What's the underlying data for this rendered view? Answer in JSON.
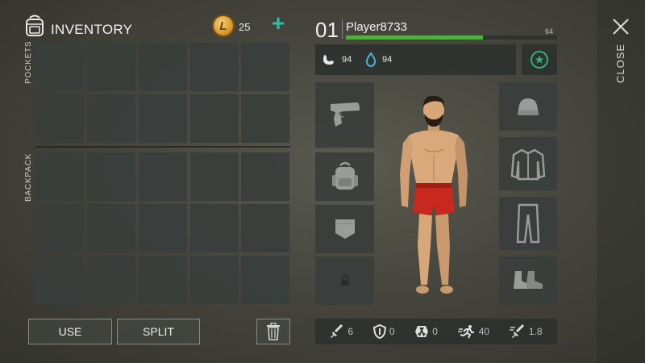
{
  "header": {
    "title": "INVENTORY",
    "coins": "25",
    "add_label": "+"
  },
  "sections": {
    "pockets_label": "POCKETS",
    "backpack_label": "BACKPACK"
  },
  "actions": {
    "use_label": "USE",
    "split_label": "SPLIT"
  },
  "character": {
    "level": "01",
    "name": "Player8733",
    "xp_value": "64",
    "xp_fraction": 0.64,
    "food": "94",
    "water": "94"
  },
  "equipment": {
    "left_slots": [
      "weapon",
      "backpack",
      "pocket",
      "locked"
    ],
    "right_slots": [
      "head",
      "torso",
      "legs",
      "feet"
    ]
  },
  "bottom_stats": {
    "attack": "6",
    "defense": "0",
    "radiation": "0",
    "speed": "40",
    "attack_speed": "1.8"
  },
  "close_label": "CLOSE",
  "colors": {
    "accent": "#2fbfa5",
    "xp_bar": "#4fb040",
    "star": "#35b07a"
  }
}
